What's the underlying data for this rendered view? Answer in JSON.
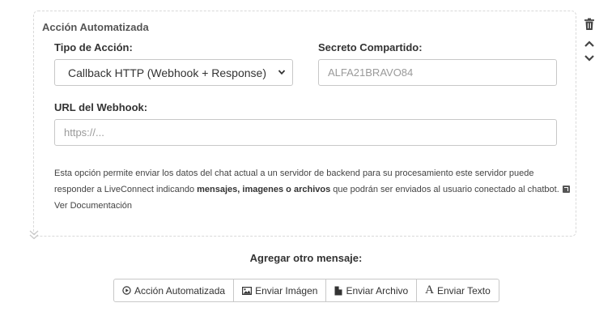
{
  "card": {
    "title": "Acción Automatizada"
  },
  "action_type": {
    "label": "Tipo de Acción:",
    "selected": "Callback HTTP (Webhook + Response)"
  },
  "shared_secret": {
    "label": "Secreto Compartido:",
    "value": "ALFA21BRAVO84"
  },
  "webhook_url": {
    "label": "URL del Webhook:",
    "placeholder": "https://..."
  },
  "help": {
    "text_before": "Esta opción permite enviar los datos del chat actual a un servidor de backend para su procesamiento este servidor puede responder a LiveConnect indicando ",
    "bold": "mensajes, imagenes o archivos",
    "text_after": " que podrán ser enviados al usuario conectado al chatbot. ",
    "link_icon": "external-link-icon",
    "link_label": "Ver Documentación"
  },
  "side_controls": {
    "delete_icon": "trash-icon",
    "up_icon": "chevron-up-icon",
    "down_icon": "chevron-down-icon",
    "collapse_icon": "double-chevron-down-icon"
  },
  "add_message": {
    "title": "Agregar otro mensaje:",
    "buttons": [
      {
        "label": "Acción Automatizada",
        "icon": "play-circle-icon"
      },
      {
        "label": "Enviar Imágen",
        "icon": "image-icon"
      },
      {
        "label": "Enviar Archivo",
        "icon": "file-icon"
      },
      {
        "label": "Enviar Texto",
        "icon": "text-icon",
        "glyph": "A"
      }
    ]
  }
}
